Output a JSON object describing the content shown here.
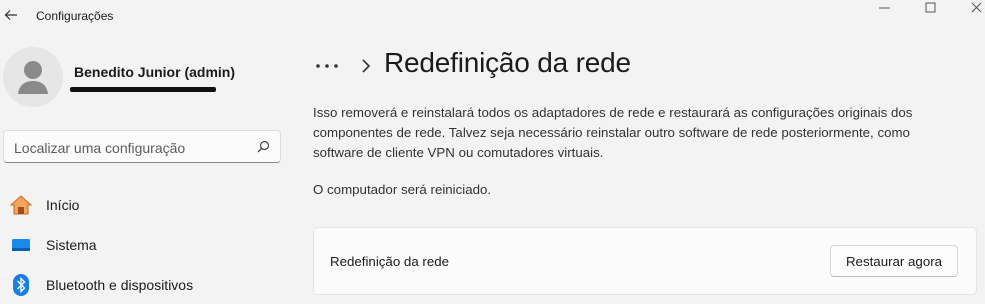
{
  "window": {
    "title": "Configurações",
    "controls": [
      "minimize-icon",
      "maximize-icon",
      "close-icon"
    ]
  },
  "user": {
    "name": "Benedito Junior (admin)",
    "email_redacted": true
  },
  "search": {
    "placeholder": "Localizar uma configuração",
    "icon": "search-icon"
  },
  "sidebar": {
    "items": [
      {
        "label": "Início",
        "icon": "home-icon",
        "color": "#e8833a"
      },
      {
        "label": "Sistema",
        "icon": "monitor-icon",
        "color": "#0a74d6"
      },
      {
        "label": "Bluetooth e dispositivos",
        "icon": "bluetooth-icon",
        "color": "#1a7fe0"
      }
    ]
  },
  "header": {
    "breadcrumb_more": "•••",
    "title": "Redefinição da rede"
  },
  "main": {
    "description": "Isso removerá e reinstalará todos os adaptadores de rede e restaurará as configurações originais dos componentes de rede. Talvez seja necessário reinstalar outro software de rede posteriormente, como software de cliente VPN ou comutadores virtuais.",
    "notice": "O computador será reiniciado.",
    "card": {
      "label": "Redefinição da rede",
      "button_label": "Restaurar agora"
    }
  }
}
